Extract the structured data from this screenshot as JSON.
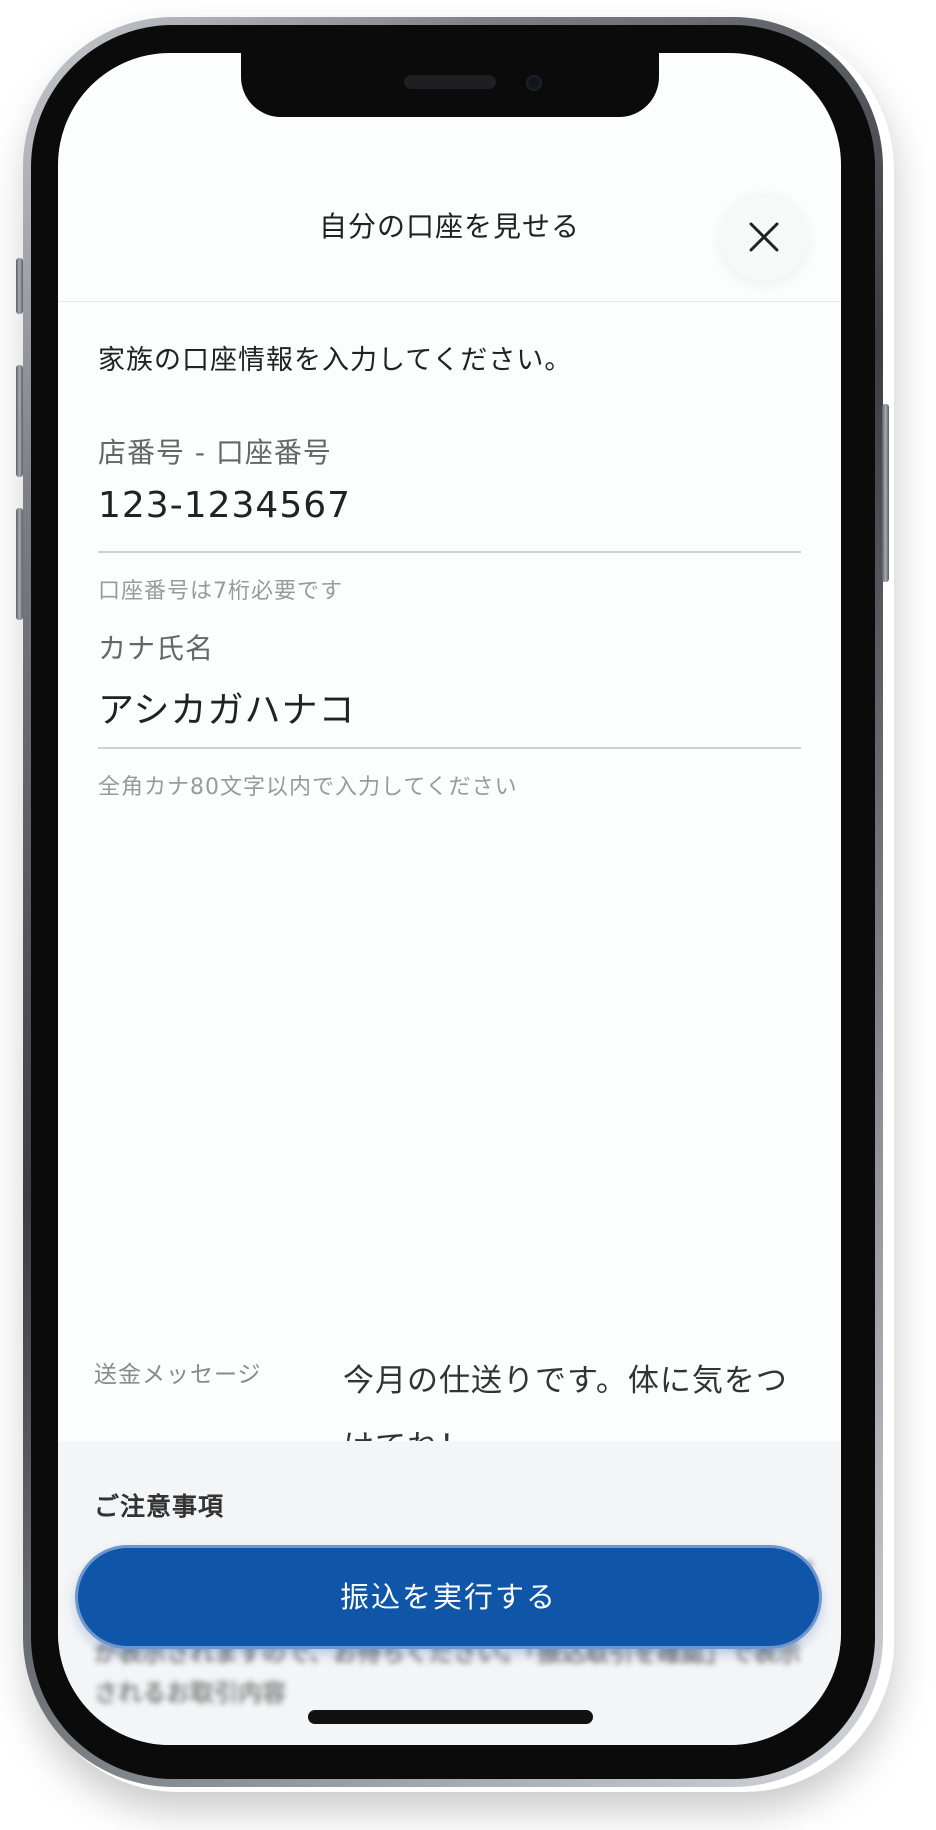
{
  "header": {
    "title": "自分の口座を見せる"
  },
  "intro_text": "家族の口座情報を入力してください。",
  "fields": {
    "account": {
      "label": "店番号 - 口座番号",
      "value": "123-1234567",
      "hint": "口座番号は7桁必要です"
    },
    "kana_name": {
      "label": "カナ氏名",
      "value": "アシカガハナコ",
      "hint": "全角カナ80文字以内で入力してください"
    }
  },
  "message": {
    "label": "送金メッセージ",
    "text": "今月の仕送りです。体に気をつけてね！"
  },
  "notice": {
    "title": "ご注意事項",
    "body": "「振込を実行する」ボタンをタップいただいた後、セキュリティパスワードをご入力いただくと、「振込取引を確認するポップアップ」が表示されますので、お待ちください。「振込取引を確認」で表示されるお取引内容"
  },
  "submit_button": {
    "label": "振込を実行する"
  },
  "icons": {
    "close": "close-icon"
  },
  "colors": {
    "primary": "#1056a8",
    "background": "#fcfdfd",
    "notice_background": "#f4f5f6"
  }
}
